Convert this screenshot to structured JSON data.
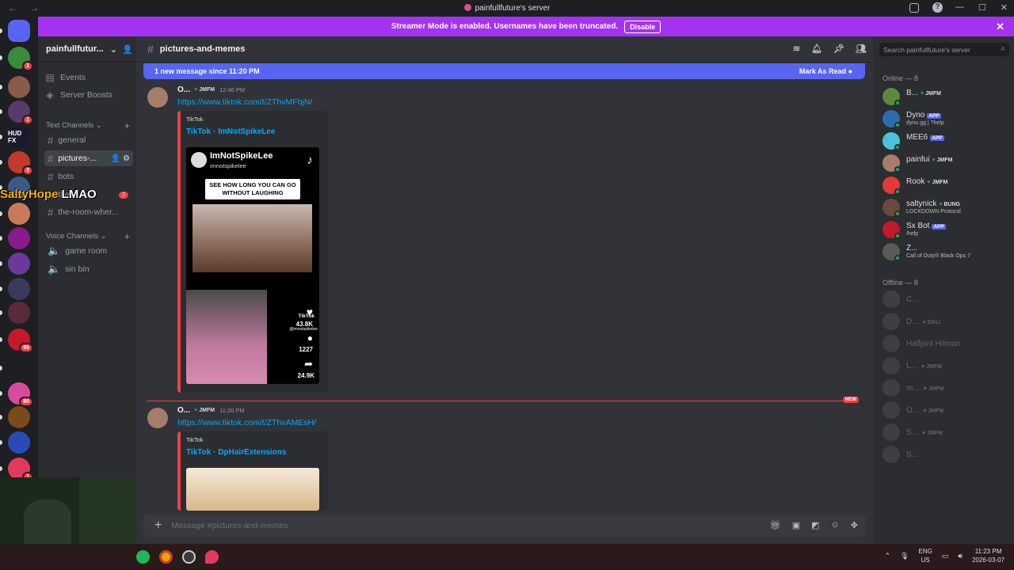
{
  "window": {
    "title": "painfullfuture's server"
  },
  "banner": {
    "text": "Streamer Mode is enabled. Usernames have been truncated.",
    "button": "Disable"
  },
  "overlay": {
    "name": "SaltyHope",
    "text": "LMAO"
  },
  "guilds": [
    {
      "label": "",
      "badge": "",
      "color": "#5865f2"
    },
    {
      "label": "",
      "badge": "1",
      "color": "#3b8a3b"
    },
    {
      "label": "",
      "badge": "",
      "color": "#8a5a4a"
    },
    {
      "label": "",
      "badge": "1",
      "color": "#5a3a6a"
    },
    {
      "label": "HUD FX",
      "badge": "",
      "color": "#1a1a2e"
    },
    {
      "label": "",
      "badge": "2",
      "color": "#c23a2a"
    },
    {
      "label": "",
      "badge": "",
      "color": "#3a5a8a"
    },
    {
      "label": "",
      "badge": "",
      "color": "#c87a5a"
    },
    {
      "label": "",
      "badge": "",
      "color": "#8a1a8a"
    },
    {
      "label": "",
      "badge": "",
      "color": "#6a3a9a"
    },
    {
      "label": "",
      "badge": "",
      "color": "#3a3a5a"
    },
    {
      "label": "",
      "badge": "",
      "color": "#5a2a3a"
    },
    {
      "label": "",
      "badge": "85",
      "color": "#c21a2a"
    },
    {
      "label": "",
      "badge": "",
      "color": "#1e1f22"
    },
    {
      "label": "",
      "badge": "80",
      "color": "#d94a9a"
    },
    {
      "label": "",
      "badge": "",
      "color": "#7a4a1a"
    },
    {
      "label": "",
      "badge": "",
      "color": "#2a4ab8"
    },
    {
      "label": "",
      "badge": "1",
      "color": "#e23a5a"
    }
  ],
  "sidebar": {
    "server_name": "painfullfutur...",
    "events": "Events",
    "boosts": "Server Boosts",
    "text_category": "Text Channels",
    "text_channels": [
      {
        "name": "general",
        "badge": ""
      },
      {
        "name": "pictures-...",
        "badge": ""
      },
      {
        "name": "bots",
        "badge": ""
      },
      {
        "name": "the-...",
        "badge": "2"
      },
      {
        "name": "the-room-wher...",
        "badge": ""
      }
    ],
    "voice_category": "Voice Channels",
    "voice_channels": [
      "game room",
      "sin bin"
    ]
  },
  "channel": {
    "name": "pictures-and-memes",
    "new_message_bar": "1 new message since 11:20 PM",
    "mark_as_read": "Mark As Read",
    "composer_placeholder": "Message #pictures-and-memes"
  },
  "messages": [
    {
      "author": "O...",
      "tag": "JMFM",
      "time": "12:46 PM",
      "link": "https://www.tiktok.com/t/ZThvMFbjN/",
      "embed_provider": "TikTok",
      "embed_title": "TikTok · ImNotSpikeLee",
      "video": {
        "handle": "ImNotSpikeLee",
        "subhandle": "imnotspikelee",
        "caption": "SEE HOW LONG YOU CAN GO WITHOUT LAUGHING",
        "likes": "43.8K",
        "comments": "1227",
        "shares": "24.9K",
        "watermark": "TikTok",
        "watermark_handle": "@imnotspikelee"
      }
    },
    {
      "author": "O...",
      "tag": "JMFM",
      "time": "11:20 PM",
      "link": "https://www.tiktok.com/t/ZThvAMEsH/",
      "embed_provider": "TikTok",
      "embed_title": "TikTok · DpHairExtensions"
    }
  ],
  "new_label": "NEW",
  "members": {
    "search_placeholder": "Search painfullfuture's server",
    "online_header": "Online — 8",
    "offline_header": "Offline — 8",
    "online": [
      {
        "name": "B...",
        "tag": "JMFM",
        "sub": "",
        "color": "#5a8a3a"
      },
      {
        "name": "Dyno",
        "tag": "APP",
        "sub": "dyno.gg | ?help",
        "color": "#2b6cb0"
      },
      {
        "name": "MEE6",
        "tag": "APP",
        "sub": "",
        "color": "#49c3dc"
      },
      {
        "name": "painfui",
        "tag": "JMFM",
        "sub": "",
        "color": "#a67c6a"
      },
      {
        "name": "Rook",
        "tag": "JMFM",
        "sub": "",
        "color": "#e23a3a"
      },
      {
        "name": "saltynick",
        "tag": "BUNG",
        "sub": "LOCKDOWN Protocol",
        "color": "#6a4a3a"
      },
      {
        "name": "Sx Bot",
        "tag": "APP",
        "sub": "/help",
        "color": "#c21a2a"
      },
      {
        "name": "Z...",
        "tag": "",
        "sub": "Call of Duty® Black Ops 7",
        "color": "#5a5a5a"
      }
    ],
    "offline": [
      {
        "name": "C...",
        "tag": ""
      },
      {
        "name": "D...",
        "tag": "DALI"
      },
      {
        "name": "Halfpint Hitman",
        "tag": ""
      },
      {
        "name": "L...",
        "tag": "JMFM"
      },
      {
        "name": "m...",
        "tag": "JMFM"
      },
      {
        "name": "O...",
        "tag": "JMFM"
      },
      {
        "name": "S...",
        "tag": "JMFM"
      },
      {
        "name": "S...",
        "tag": ""
      }
    ]
  },
  "taskbar": {
    "lang": "ENG",
    "region": "US",
    "time": "11:23 PM",
    "date": "2026-03-07"
  }
}
